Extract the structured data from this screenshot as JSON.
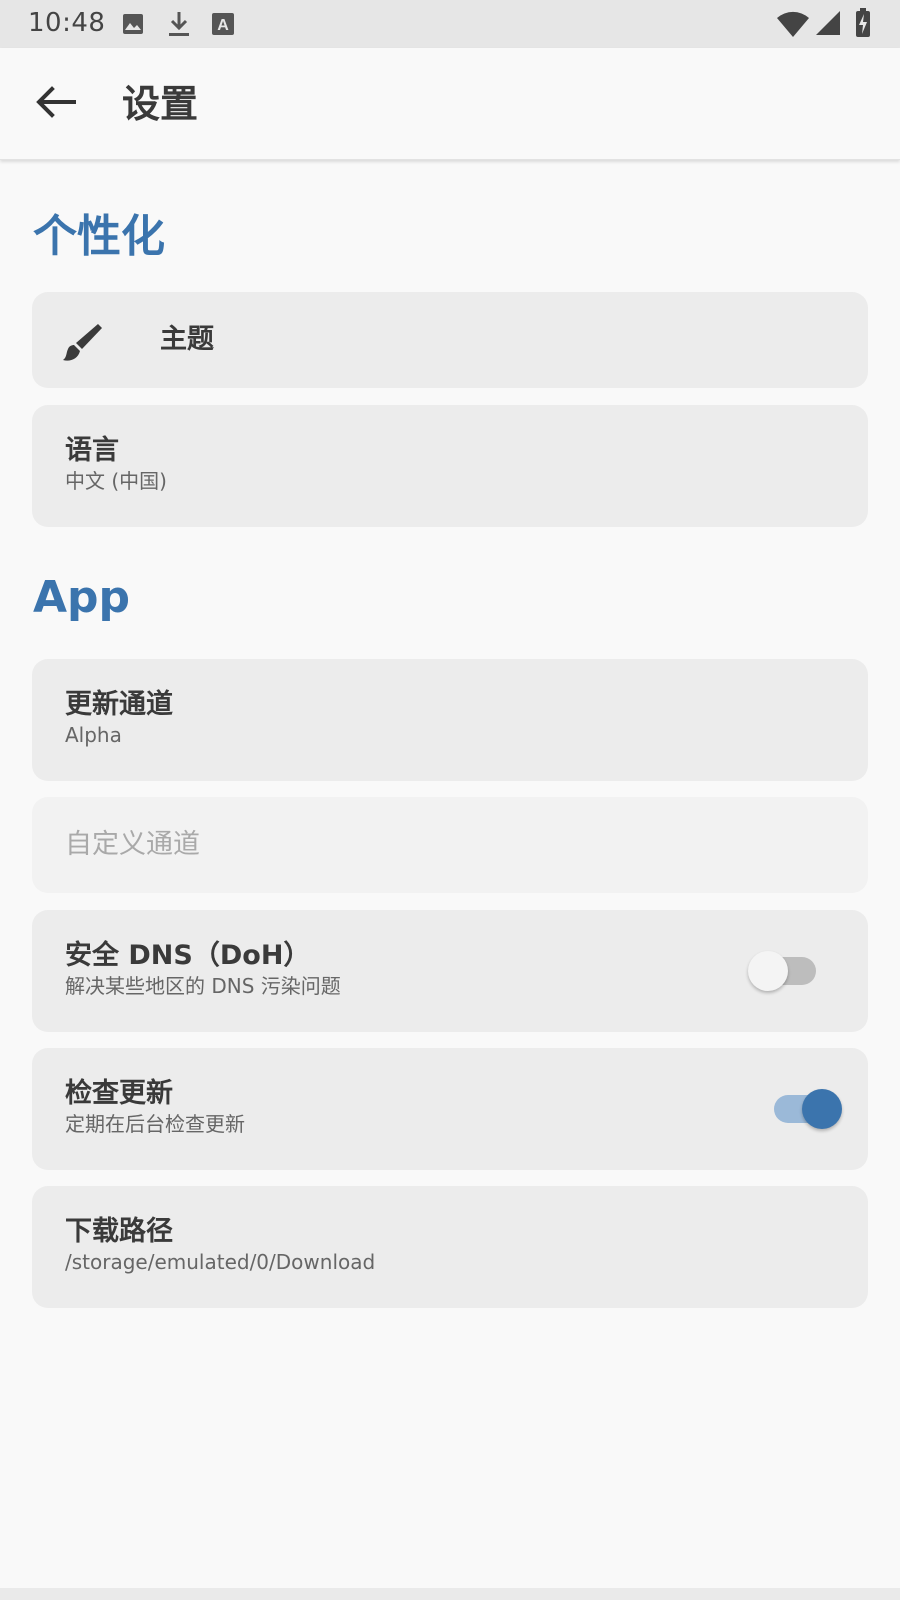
{
  "status_bar": {
    "time": "10:48",
    "left_icons": [
      "image-icon",
      "download-icon",
      "text-box-icon"
    ],
    "right_icons": [
      "wifi-icon",
      "cell-signal-icon",
      "battery-charging-icon"
    ]
  },
  "app_bar": {
    "title": "设置",
    "back_icon": "arrow-back-icon"
  },
  "sections": {
    "personalization": {
      "title": "个性化",
      "theme": {
        "label": "主题",
        "icon": "paintbrush-icon"
      },
      "language": {
        "label": "语言",
        "value": "中文 (中国)"
      }
    },
    "app": {
      "title": "App",
      "update_channel": {
        "label": "更新通道",
        "value": "Alpha"
      },
      "custom_channel": {
        "label": "自定义通道",
        "enabled": false
      },
      "secure_dns": {
        "label": "安全 DNS（DoH）",
        "description": "解决某些地区的 DNS 污染问题",
        "checked": false
      },
      "check_updates": {
        "label": "检查更新",
        "description": "定期在后台检查更新",
        "checked": true
      },
      "download_path": {
        "label": "下载路径",
        "value": "/storage/emulated/0/Download"
      }
    }
  },
  "colors": {
    "accent": "#3b74ad",
    "card_background": "#ececec",
    "page_background": "#f9f9f9"
  }
}
